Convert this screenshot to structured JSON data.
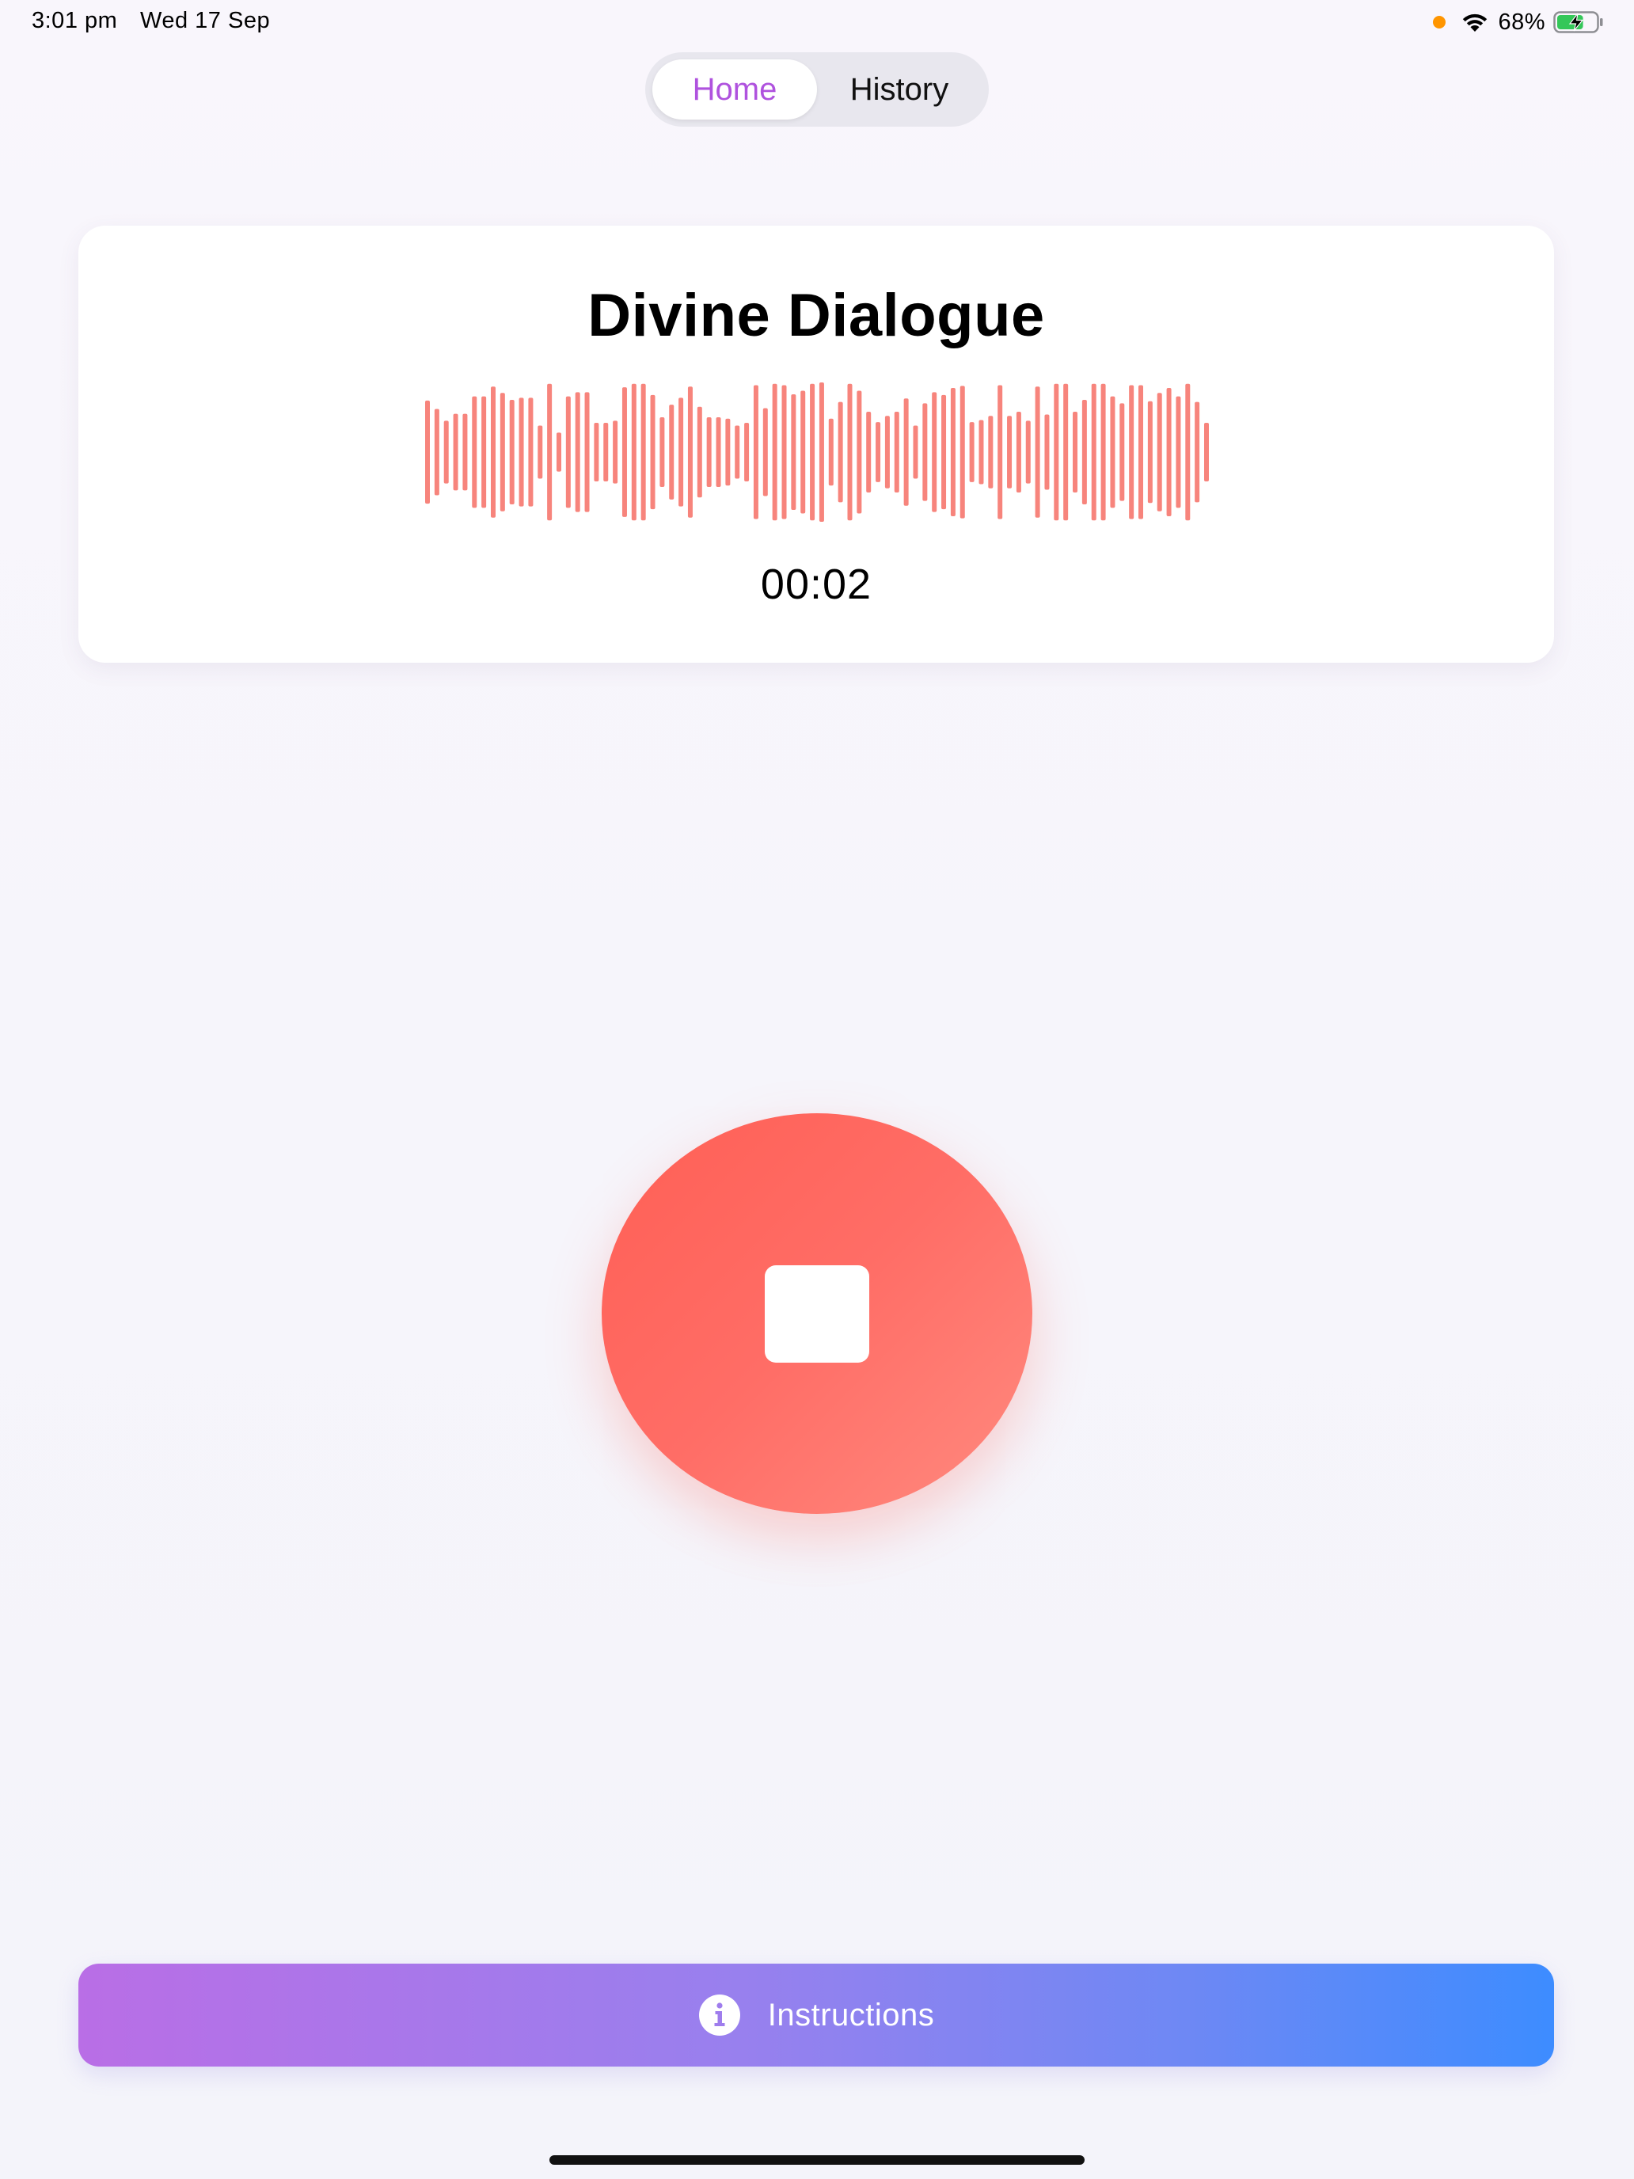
{
  "status_bar": {
    "time": "3:01 pm",
    "date": "Wed 17 Sep",
    "battery": "68%",
    "icons": [
      "microphone-in-use-dot",
      "wifi-icon",
      "battery-charging-icon"
    ],
    "mic_dot_color": "#ff9500",
    "battery_fill_color": "#34c759",
    "battery_level": 0.68
  },
  "tabs": {
    "items": [
      {
        "label": "Home",
        "selected": true
      },
      {
        "label": "History",
        "selected": false
      }
    ],
    "selected_color": "#af52de"
  },
  "recording_card": {
    "title": "Divine Dialogue",
    "timer": "00:02",
    "waveform_color": "#f7847c",
    "waveform_levels": [
      0.74,
      0.62,
      0.45,
      0.55,
      0.55,
      0.8,
      0.8,
      0.94,
      0.85,
      0.75,
      0.78,
      0.78,
      0.38,
      0.98,
      0.28,
      0.8,
      0.86,
      0.86,
      0.42,
      0.42,
      0.45,
      0.93,
      0.98,
      0.98,
      0.82,
      0.5,
      0.68,
      0.78,
      0.94,
      0.65,
      0.5,
      0.5,
      0.48,
      0.38,
      0.42,
      0.96,
      0.63,
      0.98,
      0.96,
      0.83,
      0.88,
      0.98,
      1.0,
      0.48,
      0.72,
      0.98,
      0.88,
      0.58,
      0.43,
      0.52,
      0.58,
      0.77,
      0.38,
      0.7,
      0.86,
      0.82,
      0.92,
      0.95,
      0.43,
      0.46,
      0.52,
      0.96,
      0.52,
      0.58,
      0.45,
      0.94,
      0.54,
      0.98,
      0.98,
      0.58,
      0.75,
      0.98,
      0.98,
      0.8,
      0.7,
      0.96,
      0.96,
      0.73,
      0.85,
      0.92,
      0.8,
      0.98,
      0.72,
      0.42
    ]
  },
  "record_button": {
    "state": "recording",
    "color": "#ff6b63",
    "icon": "stop-icon"
  },
  "instructions_button": {
    "label": "Instructions",
    "icon": "info-icon",
    "gradient_start": "#b96ee6",
    "gradient_end": "#3d8cff"
  }
}
